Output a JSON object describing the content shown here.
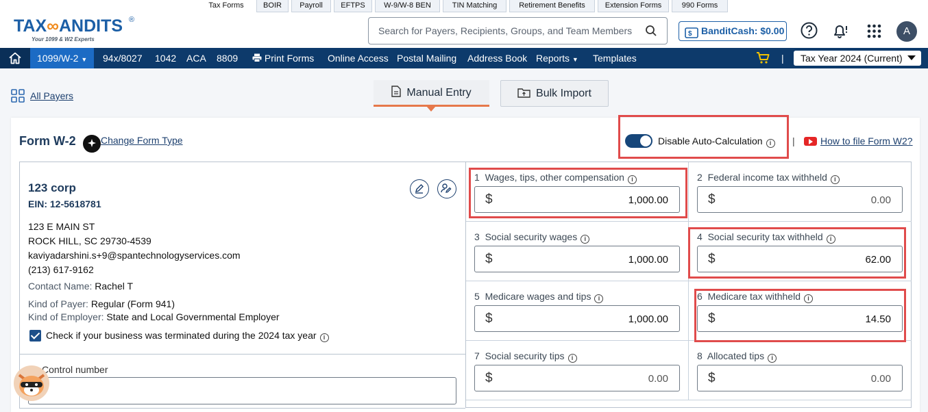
{
  "top_tabs": [
    "Tax Forms",
    "BOIR",
    "Payroll",
    "EFTPS",
    "W-9/W-8 BEN",
    "TIN Matching",
    "Retirement Benefits",
    "Extension Forms",
    "990 Forms"
  ],
  "brand": {
    "logo_left": "TAX",
    "logo_right": "ANDITS",
    "registered": "®",
    "tagline": "Your 1099 & W2 Experts"
  },
  "search": {
    "placeholder": "Search for Payers, Recipients, Groups, and Team Members"
  },
  "bandit_cash": {
    "label": "BanditCash:",
    "amount": "$0.00"
  },
  "user": {
    "initial": "A"
  },
  "icons": {
    "search": "search-icon",
    "help": "help-circle-icon",
    "notifications": "bell-icon",
    "apps": "grid-dots-icon",
    "home": "home-icon",
    "cart": "cart-icon",
    "print": "printer-icon",
    "edit": "pencil-icon",
    "assign": "user-edit-icon",
    "youtube": "youtube-icon",
    "info": "info-icon",
    "payers": "payers-grid-icon",
    "manual": "document-icon",
    "bulk": "upload-icon"
  },
  "nav": {
    "items": [
      "1099/W-2",
      "94x/8027",
      "1042",
      "ACA",
      "8809",
      "Print Forms",
      "Online Access",
      "Postal Mailing",
      "Address Book",
      "Reports",
      "Templates"
    ],
    "divider": "|",
    "tax_year": "Tax Year 2024 (Current)"
  },
  "page": {
    "all_payers": "All Payers",
    "manual_entry": "Manual Entry",
    "bulk_import": "Bulk Import",
    "form_title": "Form W-2",
    "change_form_type": "Change Form Type",
    "auto_calc_label": "Disable Auto-Calculation",
    "auto_calc_enabled": true,
    "divider": "|",
    "how_to": "How to file Form W2?"
  },
  "payer": {
    "name": "123 corp",
    "ein": "EIN: 12-5618781",
    "address1": "123 E MAIN ST",
    "address2": "ROCK HILL, SC 29730-4539",
    "email": "kaviyadarshini.s+9@spantechnologyservices.com",
    "phone": "(213) 617-9162",
    "contact_label": "Contact Name:",
    "contact_value": "Rachel T",
    "kind_payer_label": "Kind of Payer:",
    "kind_payer_value": "Regular (Form 941)",
    "kind_employer_label": "Kind of Employer:",
    "kind_employer_value": "State and Local Governmental Employer",
    "terminated_label": "Check if your business was terminated during the 2024 tax year",
    "terminated_checked": true
  },
  "control": {
    "label": "Control number",
    "value": ""
  },
  "boxes": [
    {
      "num": "1",
      "label": "Wages, tips, other compensation",
      "value": "1,000.00"
    },
    {
      "num": "2",
      "label": "Federal income tax withheld",
      "value": "0.00"
    },
    {
      "num": "3",
      "label": "Social security wages",
      "value": "1,000.00"
    },
    {
      "num": "4",
      "label": "Social security tax withheld",
      "value": "62.00"
    },
    {
      "num": "5",
      "label": "Medicare wages and tips",
      "value": "1,000.00"
    },
    {
      "num": "6",
      "label": "Medicare tax withheld",
      "value": "14.50"
    },
    {
      "num": "7",
      "label": "Social security tips",
      "value": "0.00"
    },
    {
      "num": "8",
      "label": "Allocated tips",
      "value": "0.00"
    }
  ],
  "currency_symbol": "$",
  "highlight_color": "#e04b4b",
  "brand_color": "#0d3a6b"
}
